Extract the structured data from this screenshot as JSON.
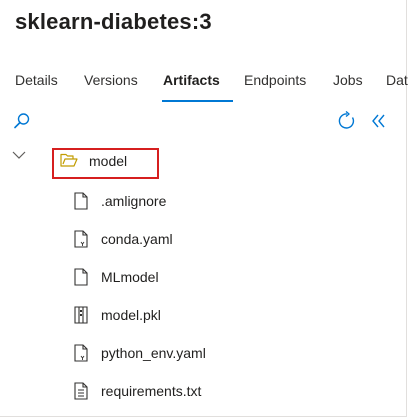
{
  "page": {
    "title": "sklearn-diabetes:3"
  },
  "tabs": [
    {
      "label": "Details",
      "active": false
    },
    {
      "label": "Versions",
      "active": false
    },
    {
      "label": "Artifacts",
      "active": true
    },
    {
      "label": "Endpoints",
      "active": false
    },
    {
      "label": "Jobs",
      "active": false
    },
    {
      "label": "Dat",
      "active": false
    }
  ],
  "toolbar": {
    "search_icon": "search-icon",
    "refresh_icon": "refresh-icon",
    "collapse_icon": "double-chevron-left-icon"
  },
  "tree": {
    "folder": {
      "name": "model",
      "icon": "folder-open-icon",
      "expanded": true,
      "selected": true
    },
    "files": [
      {
        "name": ".amlignore",
        "icon": "document-icon"
      },
      {
        "name": "conda.yaml",
        "icon": "yaml-file-icon"
      },
      {
        "name": "MLmodel",
        "icon": "document-icon"
      },
      {
        "name": "model.pkl",
        "icon": "binary-file-icon"
      },
      {
        "name": "python_env.yaml",
        "icon": "yaml-file-icon"
      },
      {
        "name": "requirements.txt",
        "icon": "text-file-icon"
      }
    ]
  },
  "colors": {
    "accent": "#0078d4",
    "highlight_border": "#d61f1f",
    "folder_icon": "#c19c00"
  }
}
